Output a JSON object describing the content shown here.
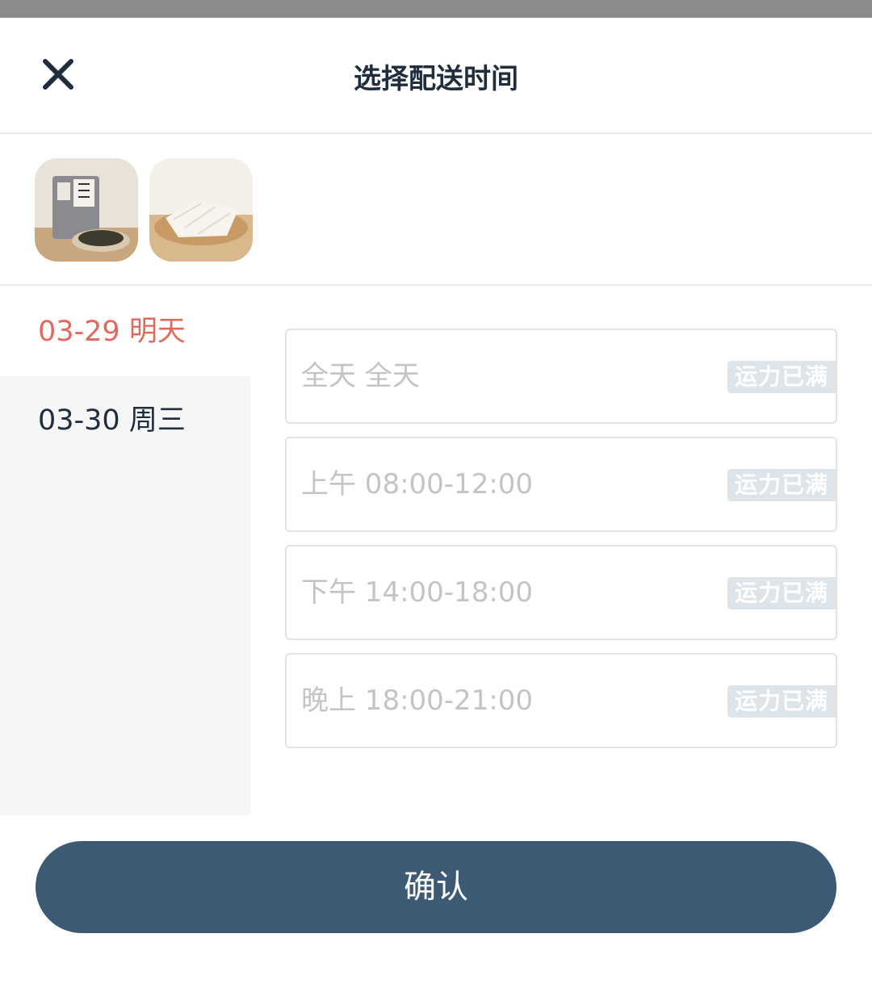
{
  "header": {
    "title": "选择配送时间",
    "close_icon": "close-icon"
  },
  "products": [
    {
      "name": "seaweed-snack-product"
    },
    {
      "name": "paper-product"
    }
  ],
  "dates": [
    {
      "label": "03-29 明天",
      "selected": true
    },
    {
      "label": "03-30 周三",
      "selected": false
    }
  ],
  "slots": [
    {
      "label": "全天 全天",
      "badge": "运力已满"
    },
    {
      "label": "上午 08:00-12:00",
      "badge": "运力已满"
    },
    {
      "label": "下午 14:00-18:00",
      "badge": "运力已满"
    },
    {
      "label": "晚上 18:00-21:00",
      "badge": "运力已满"
    }
  ],
  "confirm": {
    "label": "确认"
  },
  "colors": {
    "accent": "#e06a5e",
    "button": "#3d5a75",
    "badge": "#dde4ea",
    "disabled_text": "#c4c4c4"
  }
}
